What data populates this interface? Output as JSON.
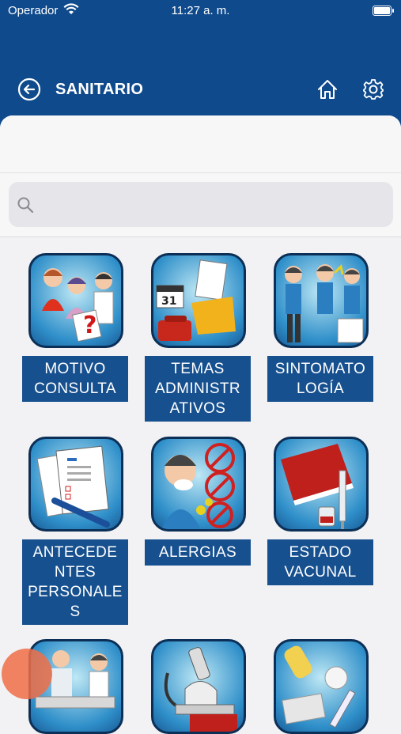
{
  "status": {
    "carrier": "Operador",
    "time": "11:27 a. m."
  },
  "nav": {
    "title": "SANITARIO"
  },
  "search": {
    "placeholder": ""
  },
  "tiles": [
    {
      "label": "MOTIVO\nCONSULTA"
    },
    {
      "label": "TEMAS\nADMINISTR\nATIVOS"
    },
    {
      "label": "SINTOMATO\nLOGÍA"
    },
    {
      "label": "ANTECEDE\nNTES\nPERSONALE\nS"
    },
    {
      "label": "ALERGIAS"
    },
    {
      "label": "ESTADO\nVACUNAL"
    },
    {
      "label": ""
    },
    {
      "label": ""
    },
    {
      "label": ""
    }
  ],
  "colors": {
    "header": "#0f4a8c",
    "label_bg": "#17508f",
    "icon_border": "#0b2f56"
  }
}
